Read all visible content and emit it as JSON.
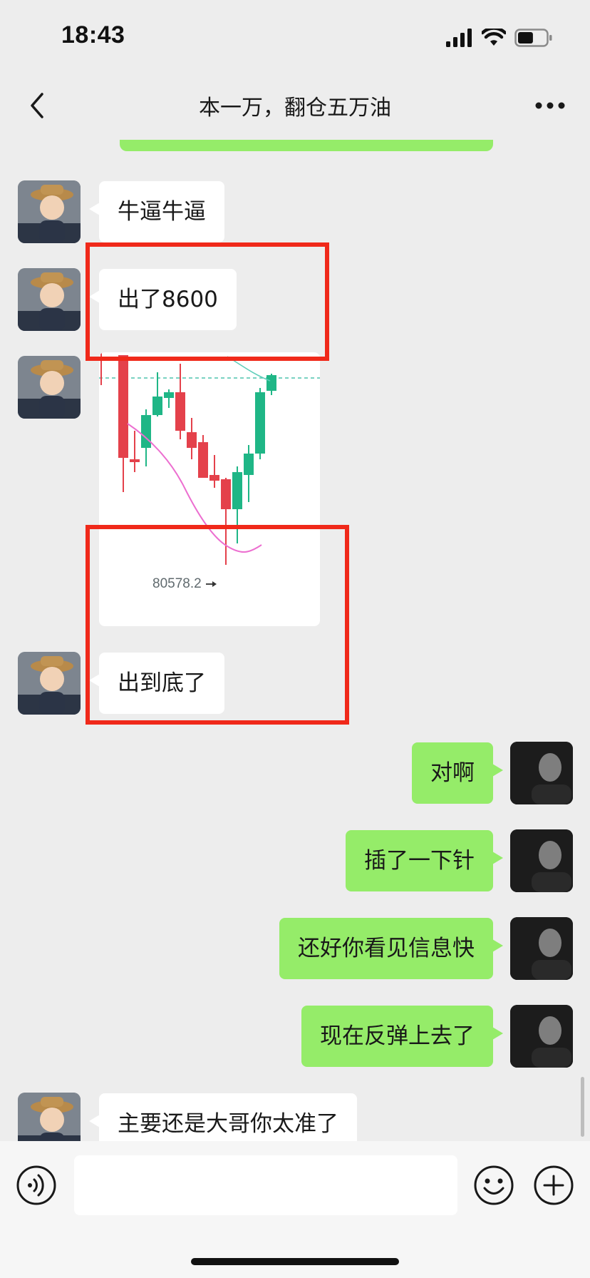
{
  "status_bar": {
    "time": "18:43",
    "battery_level": 0.55
  },
  "nav": {
    "title": "本一万，翻仓五万油",
    "back_icon": "chevron-left-icon",
    "more_icon": "more-dots-icon"
  },
  "messages": [
    {
      "sender": "other",
      "type": "text",
      "text": "牛逼牛逼"
    },
    {
      "sender": "other",
      "type": "text",
      "text": "出了8600"
    },
    {
      "sender": "other",
      "type": "image",
      "image_label": "80578.2"
    },
    {
      "sender": "other",
      "type": "text",
      "text": "出到底了"
    },
    {
      "sender": "self",
      "type": "text",
      "text": "对啊"
    },
    {
      "sender": "self",
      "type": "text",
      "text": "插了一下针"
    },
    {
      "sender": "self",
      "type": "text",
      "text": "还好你看见信息快"
    },
    {
      "sender": "self",
      "type": "text",
      "text": "现在反弹上去了"
    },
    {
      "sender": "other",
      "type": "text",
      "text": "主要还是大哥你太准了"
    }
  ],
  "colors": {
    "background": "#ededed",
    "bubble_self": "#95ec69",
    "bubble_other": "#ffffff",
    "highlight": "#f0291a",
    "candle_up": "#1fb686",
    "candle_down": "#e4414b",
    "ma_line_1": "#ec6fd0",
    "ma_line_2": "#5ccdb9"
  },
  "input_bar": {
    "voice_icon": "voice-icon",
    "emoji_icon": "emoji-icon",
    "plus_icon": "plus-icon",
    "text_value": ""
  }
}
